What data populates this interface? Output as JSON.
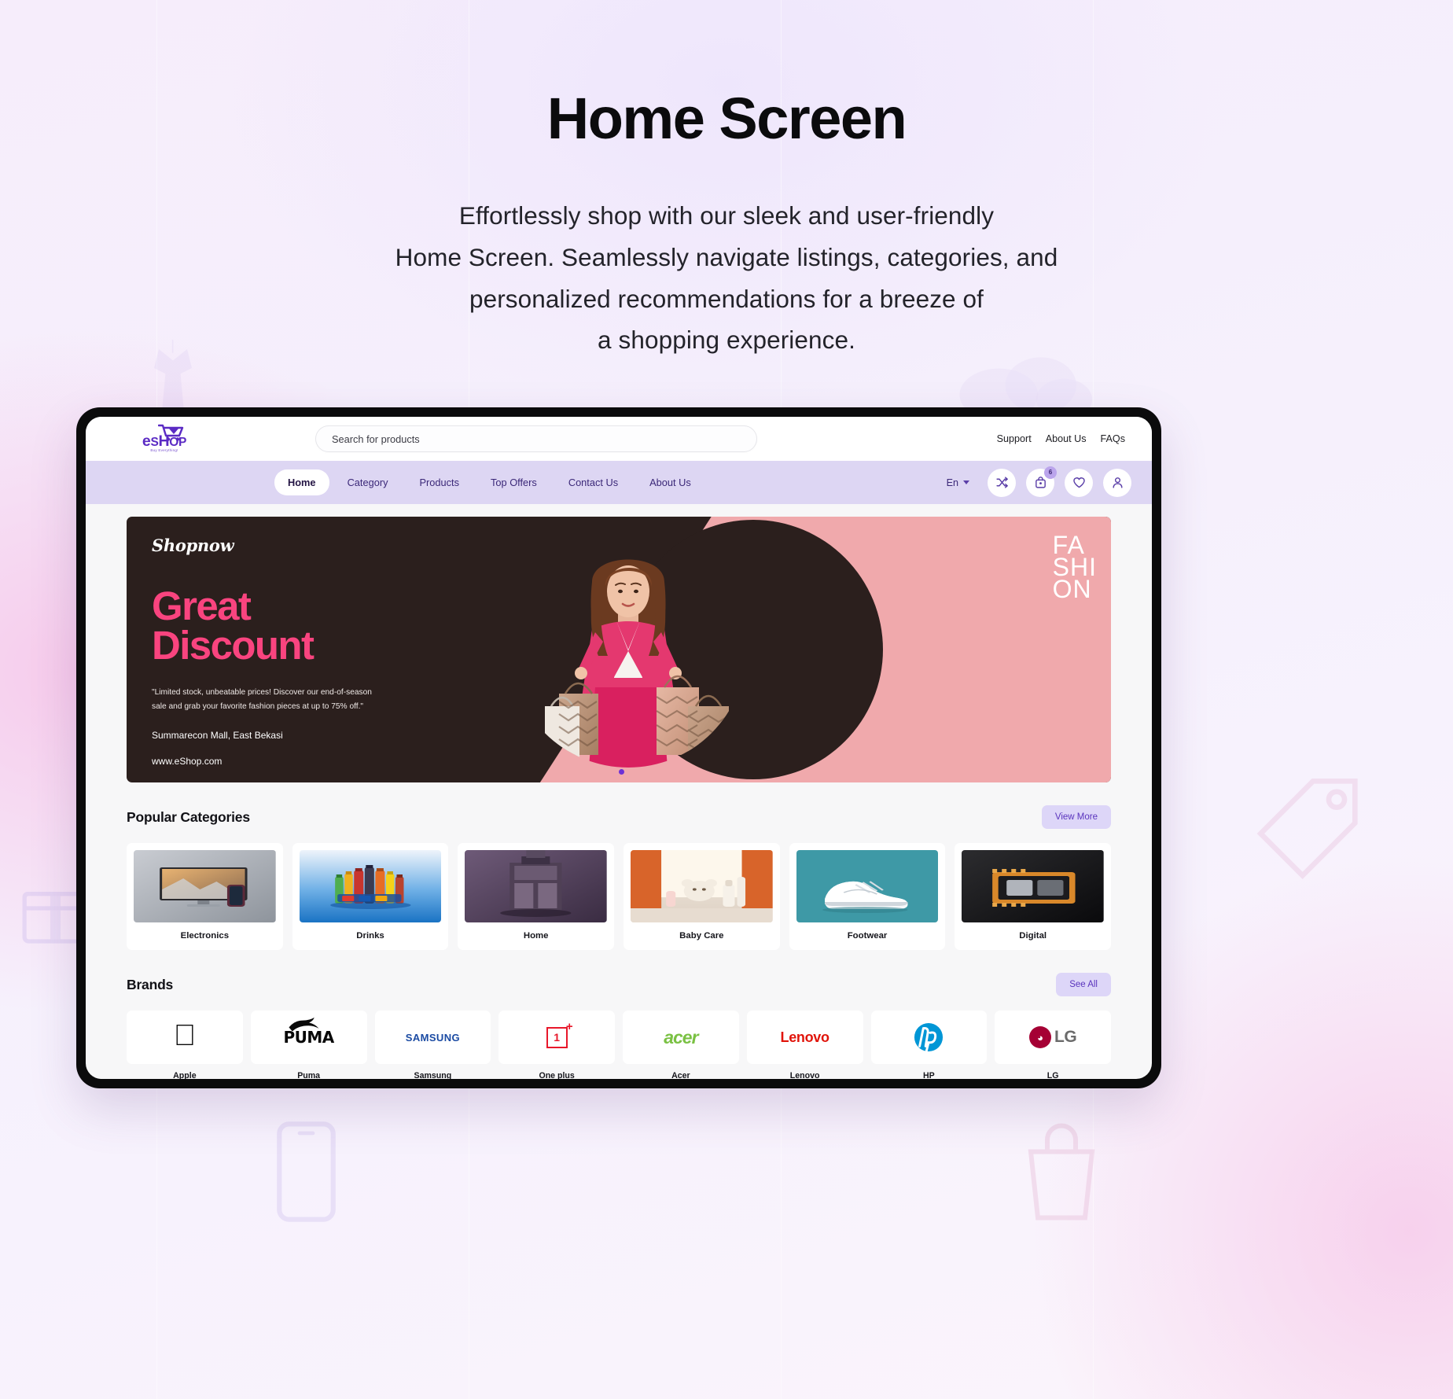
{
  "hero_section": {
    "title": "Home Screen",
    "description_lines": [
      "Effortlessly shop with our sleek and user-friendly",
      "Home Screen. Seamlessly navigate listings, categories, and",
      "personalized recommendations for a breeze of",
      "a shopping experience."
    ]
  },
  "app": {
    "header": {
      "logo_text_e": "e",
      "logo_text_shop": "S",
      "logo_text_hop": "HOP",
      "logo_tagline": "Buy Everything!",
      "search": {
        "value": "",
        "placeholder": "Search for products"
      },
      "links": [
        {
          "label": "Support"
        },
        {
          "label": "About Us"
        },
        {
          "label": "FAQs"
        }
      ]
    },
    "navbar": {
      "items": [
        {
          "label": "Home",
          "active": true
        },
        {
          "label": "Category",
          "active": false
        },
        {
          "label": "Products",
          "active": false
        },
        {
          "label": "Top Offers",
          "active": false
        },
        {
          "label": "Contact Us",
          "active": false
        },
        {
          "label": "About Us",
          "active": false
        }
      ],
      "language": "En",
      "icons": [
        {
          "name": "compare-icon"
        },
        {
          "name": "shopping-bag-icon",
          "badge": "6"
        },
        {
          "name": "wishlist-heart-icon"
        },
        {
          "name": "user-account-icon"
        }
      ],
      "cart_badge": "6"
    },
    "banner": {
      "brand": "Shopnow",
      "title_line1": "Great",
      "title_line2": "Discount",
      "description": "\"Limited stock, unbeatable prices! Discover our end-of-season sale and grab your favorite fashion pieces at up to 75% off.\"",
      "location": "Summarecon Mall, East Bekasi",
      "url": "www.eShop.com",
      "vertical_text_1": "FA",
      "vertical_text_2": "SHI",
      "vertical_text_3": "ON"
    },
    "categories_section": {
      "title": "Popular Categories",
      "action_label": "View More",
      "items": [
        {
          "label": "Electronics"
        },
        {
          "label": "Drinks"
        },
        {
          "label": "Home"
        },
        {
          "label": "Baby Care"
        },
        {
          "label": "Footwear"
        },
        {
          "label": "Digital"
        }
      ]
    },
    "brands_section": {
      "title": "Brands",
      "action_label": "See All",
      "items": [
        {
          "label": "Apple"
        },
        {
          "label": "Puma"
        },
        {
          "label": "Samsung"
        },
        {
          "label": "One plus"
        },
        {
          "label": "Acer"
        },
        {
          "label": "Lenovo"
        },
        {
          "label": "HP"
        },
        {
          "label": "LG"
        }
      ]
    }
  },
  "colors": {
    "brand_purple": "#5b2bc4",
    "nav_bar": "#ddd6f3",
    "accent_pink": "#f9447f",
    "banner_dark": "#2b1f1d",
    "banner_pink": "#f0a9ac",
    "pill_bg": "#ddd6f8"
  }
}
